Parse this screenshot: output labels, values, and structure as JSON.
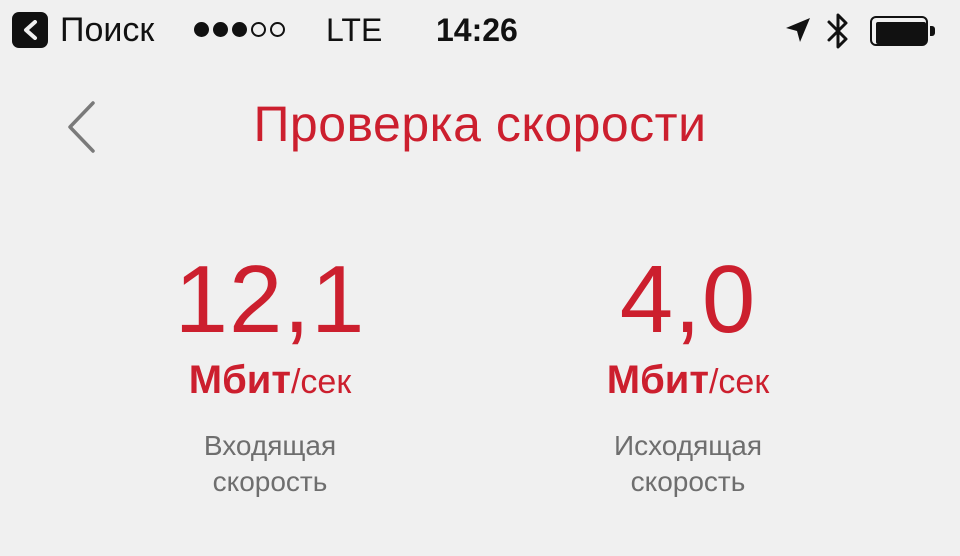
{
  "status_bar": {
    "back_app_label": "Поиск",
    "signal_strength": 3,
    "signal_max": 5,
    "network": "LTE",
    "time": "14:26",
    "battery_level": 1.0,
    "icons": [
      "back-arrow-icon",
      "location-arrow-icon",
      "bluetooth-icon",
      "battery-icon"
    ]
  },
  "nav": {
    "back_icon": "chevron-left-icon",
    "title": "Проверка скорости"
  },
  "speeds": [
    {
      "value": "12,1",
      "unit_main": "Мбит",
      "unit_sub": "/сек",
      "label": "Входящая\nскорость"
    },
    {
      "value": "4,0",
      "unit_main": "Мбит",
      "unit_sub": "/сек",
      "label": "Исходящая\nскорость"
    }
  ],
  "colors": {
    "accent": "#cc1f2e",
    "background": "#f0f0f0",
    "label_gray": "#6e6e6e",
    "status_text": "#111111"
  }
}
